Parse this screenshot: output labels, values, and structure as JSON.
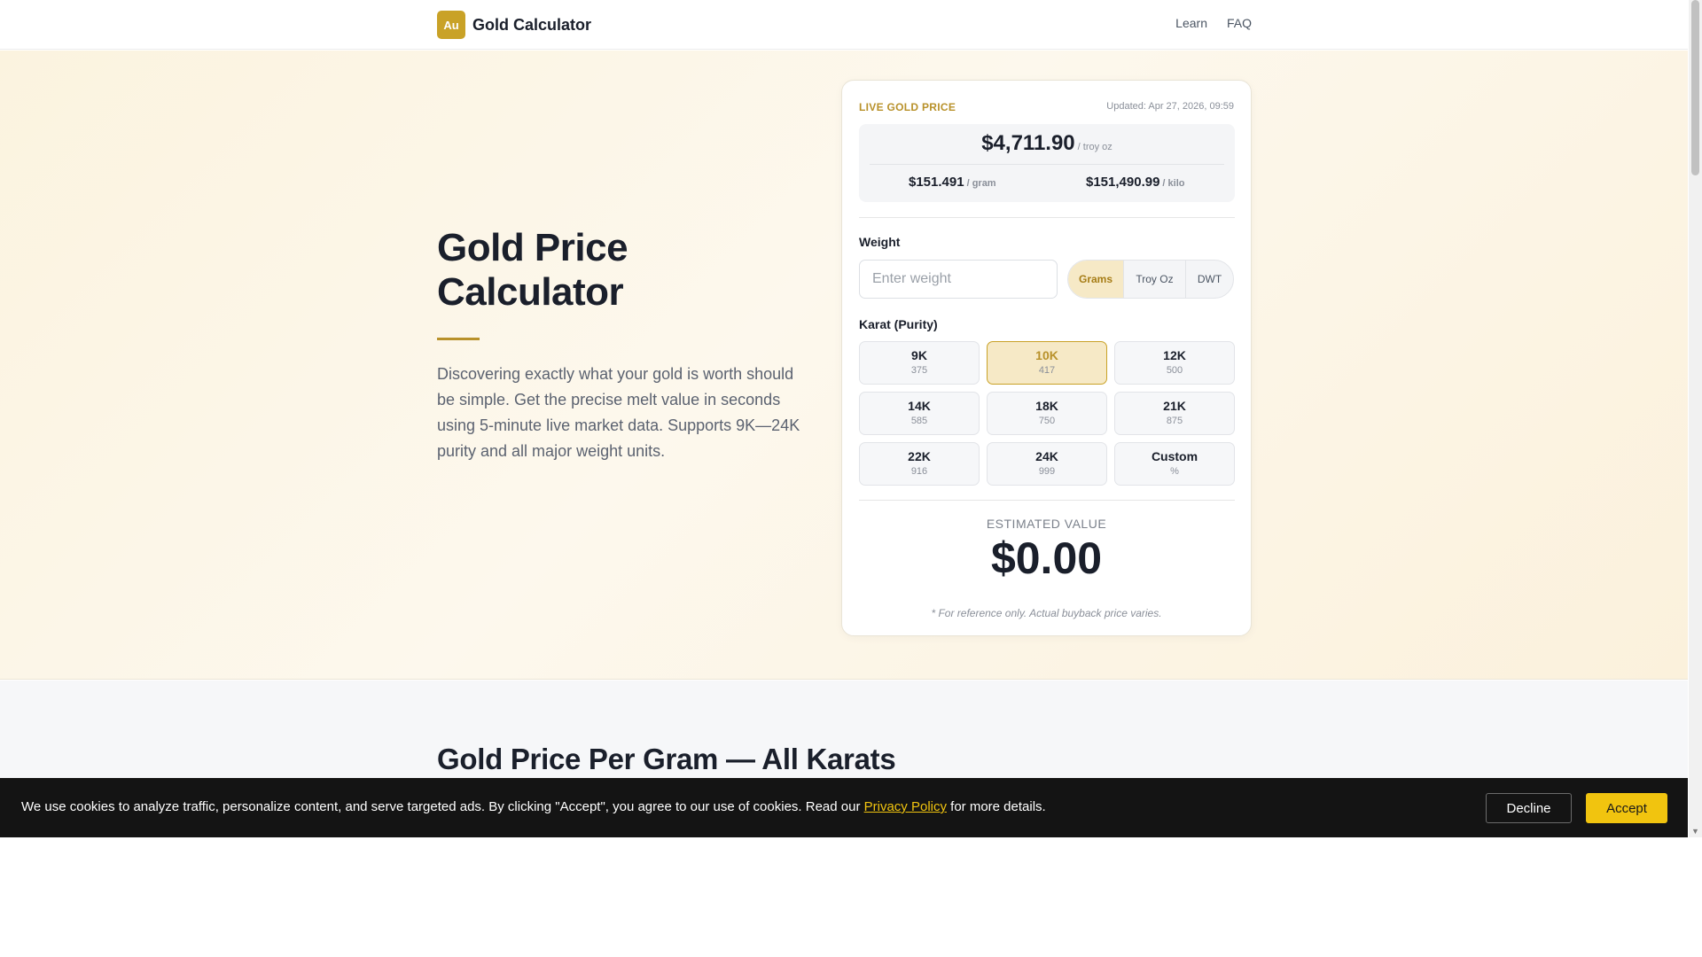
{
  "header": {
    "logo_text": "Au",
    "brand": "Gold Calculator",
    "nav": [
      "Learn",
      "FAQ"
    ]
  },
  "hero": {
    "title": "Gold Price Calculator",
    "description": "Discovering exactly what your gold is worth should be simple. Get the precise melt value in seconds using 5-minute live market data. Supports 9K—24K purity and all major weight units."
  },
  "calculator": {
    "live_label": "LIVE GOLD PRICE",
    "updated": "Updated: Apr 27, 2026, 09:59",
    "price_oz": "$4,711.90",
    "price_oz_unit": "/ troy oz",
    "price_gram": "$151.491",
    "price_gram_unit": "/ gram",
    "price_kilo": "$151,490.99",
    "price_kilo_unit": "/ kilo",
    "weight_label": "Weight",
    "weight_placeholder": "Enter weight",
    "units": [
      "Grams",
      "Troy Oz",
      "DWT"
    ],
    "selected_unit": "Grams",
    "karat_label": "Karat (Purity)",
    "karats": [
      {
        "k": "9K",
        "p": "375"
      },
      {
        "k": "10K",
        "p": "417"
      },
      {
        "k": "12K",
        "p": "500"
      },
      {
        "k": "14K",
        "p": "585"
      },
      {
        "k": "18K",
        "p": "750"
      },
      {
        "k": "21K",
        "p": "875"
      },
      {
        "k": "22K",
        "p": "916"
      },
      {
        "k": "24K",
        "p": "999"
      },
      {
        "k": "Custom",
        "p": "%"
      }
    ],
    "selected_karat": "10K",
    "estimated_label": "ESTIMATED VALUE",
    "estimated_value": "$0.00",
    "note": "* For reference only. Actual buyback price varies."
  },
  "section2": {
    "title": "Gold Price Per Gram — All Karats"
  },
  "cookie": {
    "text_before": "We use cookies to analyze traffic, personalize content, and serve targeted ads. By clicking \"Accept\", you agree to our use of cookies. Read our ",
    "link": "Privacy Policy",
    "text_after": " for more details.",
    "decline": "Decline",
    "accept": "Accept"
  },
  "colors": {
    "accent": "#c9a227",
    "accent_dark": "#b8912a",
    "cookie_bg": "#141414",
    "accept_bg": "#f1c40f"
  }
}
